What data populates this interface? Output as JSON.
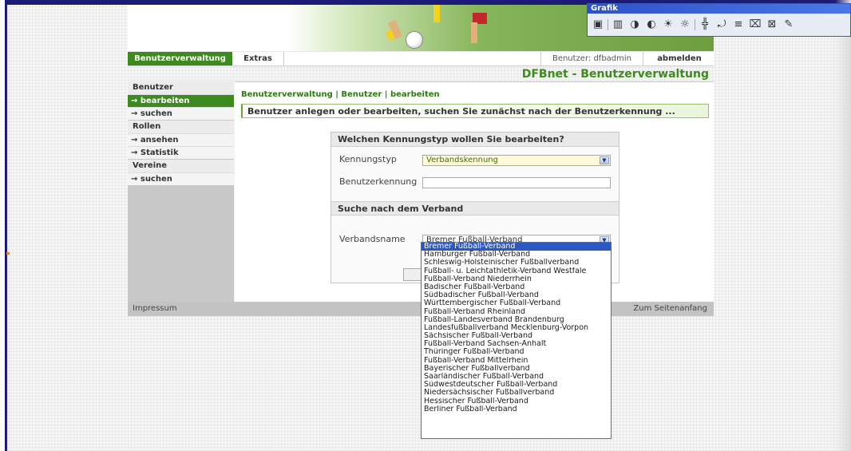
{
  "colors": {
    "accent_green": "#3d8a1f",
    "selection_blue": "#2c58c4",
    "sidebar_gray": "#c8c8c8"
  },
  "navbar": {
    "tab_active": "Benutzerverwaltung",
    "tab_extras": "Extras",
    "user_label": "Benutzer: dfbadmin",
    "logout": "abmelden"
  },
  "site_title": "DFBnet - Benutzerverwaltung",
  "sidebar": {
    "benutzer_head": "Benutzer",
    "benutzer_items": [
      "→ bearbeiten",
      "→ suchen"
    ],
    "rollen_head": "Rollen",
    "rollen_items": [
      "→ ansehen",
      "→ Statistik"
    ],
    "vereine_head": "Vereine",
    "vereine_items": [
      "→ suchen"
    ]
  },
  "breadcrumb": "Benutzerverwaltung | Benutzer | bearbeiten",
  "info_text": "Benutzer anlegen oder bearbeiten, suchen Sie zunächst nach der Benutzerkennung ...",
  "form": {
    "section1_title": "Welchen Kennungstyp wollen Sie bearbeiten?",
    "kennungstyp_label": "Kennungstyp",
    "kennungstyp_value": "Verbandskennung",
    "benutzerkennung_label": "Benutzerkennung",
    "benutzerkennung_value": "",
    "section2_title": "Suche nach dem Verband",
    "verbandsname_label": "Verbandsname",
    "verbandsname_value": "Bremer Fußball-Verband"
  },
  "dropdown_options": [
    "Bremer Fußball-Verband",
    "Hamburger Fußball-Verband",
    "Schleswig-Holsteinischer Fußballverband",
    "Fußball- u. Leichtathletik-Verband Westfale",
    "Fußball-Verband Niederrhein",
    "Badischer Fußball-Verband",
    "Südbadischer Fußball-Verband",
    "Württembergischer Fußball-Verband",
    "Fußball-Verband Rheinland",
    "Fußball-Landesverband Brandenburg",
    "Landesfußballverband Mecklenburg-Vorpon",
    "Sächsischer Fußball-Verband",
    "Fußball-Verband Sachsen-Anhalt",
    "Thüringer Fußball-Verband",
    "Fußball-Verband Mittelrhein",
    "Bayerischer Fußballverband",
    "Saarländischer Fußball-Verband",
    "Südwestdeutscher Fußball-Verband",
    "Niedersächsischer Fußballverband",
    "Hessischer Fußball-Verband",
    "Berliner Fußball-Verband"
  ],
  "footer": {
    "impressum": "Impressum",
    "top_link": "Zum Seitenanfang"
  },
  "toolwindow": {
    "title": "Grafik",
    "icons": [
      "image-icon",
      "columns-icon",
      "contrast-icon",
      "contrast-minus-icon",
      "brightness-icon",
      "brightness-minus-icon",
      "crop-icon",
      "rotate-icon",
      "line-style-icon",
      "transparent-icon",
      "reset-icon",
      "pen-icon"
    ]
  }
}
